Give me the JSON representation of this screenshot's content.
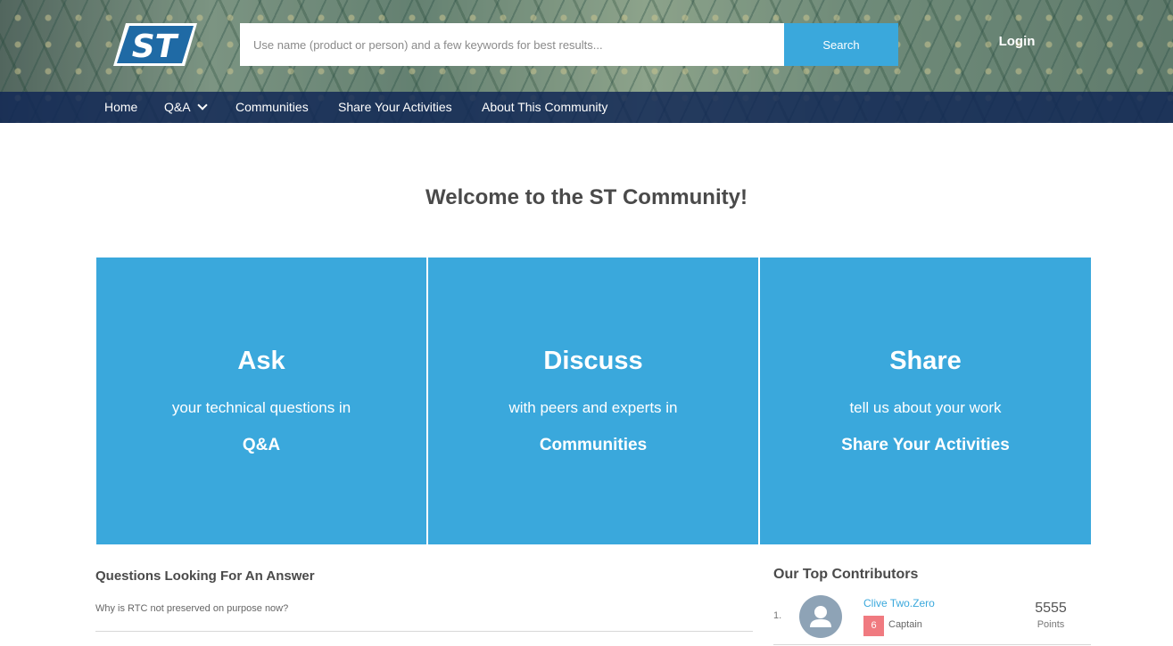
{
  "header": {
    "logo_text": "ST",
    "search": {
      "placeholder": "Use name (product or person) and a few keywords for best results...",
      "button_label": "Search"
    },
    "login_label": "Login"
  },
  "nav": {
    "items": [
      {
        "label": "Home"
      },
      {
        "label": "Q&A",
        "has_dropdown": true
      },
      {
        "label": "Communities"
      },
      {
        "label": "Share Your Activities"
      },
      {
        "label": "About This Community"
      }
    ]
  },
  "main": {
    "welcome": "Welcome to the ST Community!",
    "tiles": [
      {
        "title": "Ask",
        "subtitle": "your technical questions in",
        "link": "Q&A"
      },
      {
        "title": "Discuss",
        "subtitle": "with peers and experts in",
        "link": "Communities"
      },
      {
        "title": "Share",
        "subtitle": "tell us about your work",
        "link": "Share Your Activities"
      }
    ],
    "tile_color": "#3aa8dc"
  },
  "questions": {
    "title": "Questions Looking For An Answer",
    "items": [
      "Why is RTC not preserved on purpose now?"
    ]
  },
  "contributors": {
    "title": "Our Top Contributors",
    "items": [
      {
        "rank": "1.",
        "name": "Clive Two.Zero",
        "level": "6",
        "role": "Captain",
        "points": "5555",
        "points_label": "Points"
      }
    ]
  }
}
